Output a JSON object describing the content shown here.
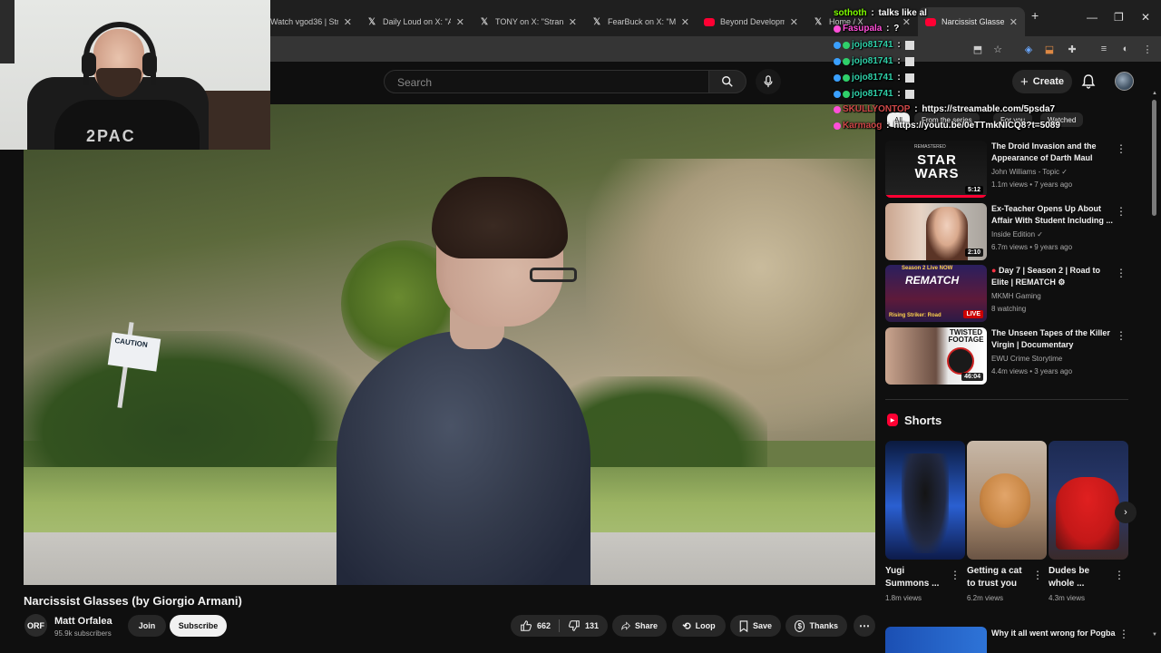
{
  "browser": {
    "tabs": [
      {
        "label": "Watch vgod36 | Strea",
        "favicon": "twitch-icon"
      },
      {
        "label": "Daily Loud on X: \"A m",
        "favicon": "x-icon"
      },
      {
        "label": "TONY on X: \"Strange",
        "favicon": "x-icon"
      },
      {
        "label": "FearBuck on X: \"Man",
        "favicon": "x-icon"
      },
      {
        "label": "Beyond Developme",
        "favicon": "youtube-icon"
      },
      {
        "label": "Home / X",
        "favicon": "x-icon"
      },
      {
        "label": "Narcissist Glasses (by",
        "favicon": "youtube-icon"
      }
    ],
    "new_tab": "+",
    "window_controls": [
      "—",
      "❐",
      "✕"
    ]
  },
  "header": {
    "search_placeholder": "Search",
    "create_label": "Create"
  },
  "video": {
    "title": "Narcissist Glasses (by Giorgio Armani)",
    "sign_text": "CAUTION"
  },
  "channel": {
    "avatar_text": "ORF",
    "name": "Matt Orfalea",
    "subscribers": "95.9k subscribers",
    "join_label": "Join",
    "subscribe_label": "Subscribe"
  },
  "actions": {
    "likes": "662",
    "dislikes": "131",
    "share": "Share",
    "loop": "Loop",
    "save": "Save",
    "thanks": "Thanks"
  },
  "chips": [
    "All",
    "From the series",
    "For you",
    "Watched"
  ],
  "recommendations": [
    {
      "title": "The Droid Invasion and the Appearance of Darth Maul",
      "channel": "John Williams - Topic",
      "meta": "1.1m views • 7 years ago",
      "duration": "5:12",
      "thumb_text": "STAR WARS",
      "thumb_sub": "REMASTERED"
    },
    {
      "title": "Ex-Teacher Opens Up About Affair With Student Including ...",
      "channel": "Inside Edition",
      "meta": "6.7m views • 9 years ago",
      "duration": "2:10"
    },
    {
      "title": "Day 7 | Season 2 | Road to Elite | REMATCH",
      "channel": "MKMH Gaming",
      "meta": "8 watching",
      "live": "LIVE",
      "thumb_top": "Season 2 Live NOW",
      "thumb_mid": "REMATCH",
      "thumb_bottom": "Rising Striker: Road"
    },
    {
      "title": "The Unseen Tapes of the Killer Virgin | Documentary",
      "channel": "EWU Crime Storytime",
      "meta": "4.4m views • 3 years ago",
      "duration": "46:04",
      "thumb_text": "TWISTED FOOTAGE"
    }
  ],
  "shorts": {
    "heading": "Shorts",
    "items": [
      {
        "title": "Yugi Summons ...",
        "views": "1.8m views"
      },
      {
        "title": "Getting a cat to trust you",
        "views": "6.2m views"
      },
      {
        "title": "Dudes be whole ...",
        "views": "4.3m views"
      }
    ]
  },
  "bottom_rec": {
    "title": "Why it all went wrong for Pogba"
  },
  "chat": [
    {
      "user": "sothoth",
      "text": "talks like al",
      "color": "#7fff00"
    },
    {
      "user": "Fasupala",
      "text": "?",
      "color": "#ff4fd8"
    },
    {
      "user": "jojo81741",
      "text": "",
      "color": "#2fd0a8"
    },
    {
      "user": "jojo81741",
      "text": "",
      "color": "#2fd0a8"
    },
    {
      "user": "jojo81741",
      "text": "",
      "color": "#2fd0a8"
    },
    {
      "user": "jojo81741",
      "text": "",
      "color": "#2fd0a8"
    },
    {
      "user": "SKULLYONTOP",
      "text": "https://streamable.com/5psda7",
      "color": "#d04848"
    },
    {
      "user": "Karmaog",
      "text": "https://youtu.be/0eTTmkNICQ8?t=5089",
      "color": "#d04848"
    }
  ],
  "webcam": {
    "shirt_text": "2PAC"
  },
  "colors": {
    "youtube_red": "#ff0033",
    "background": "#0f0f0f",
    "live_red": "#cc0000"
  }
}
